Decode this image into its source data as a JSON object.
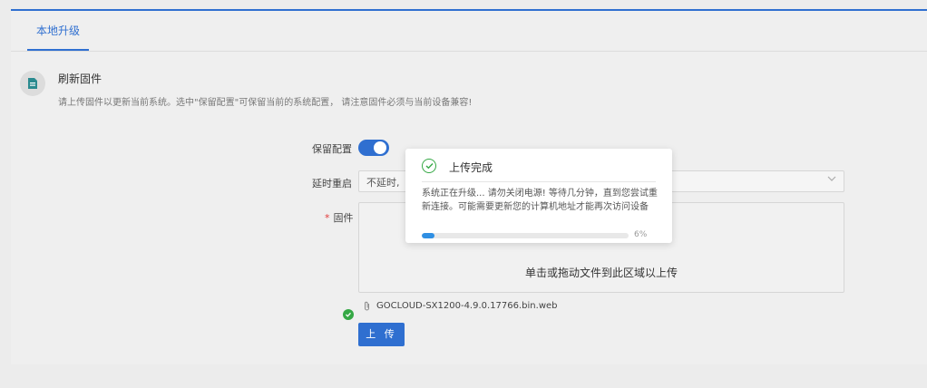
{
  "tabs": [
    {
      "label": "本地升级"
    }
  ],
  "section": {
    "title": "刷新固件",
    "description": "请上传固件以更新当前系统。选中\"保留配置\"可保留当前的系统配置， 请注意固件必须与当前设备兼容!"
  },
  "form": {
    "keep_config_label": "保留配置",
    "keep_config_on": true,
    "delay_restart_label": "延时重启",
    "delay_restart_value": "不延时,",
    "firmware_required_mark": "*",
    "firmware_label": "固件",
    "dropzone_text": "单击或拖动文件到此区域以上传",
    "file_name": "GOCLOUD-SX1200-4.9.0.17766.bin.web",
    "upload_button": "上 传"
  },
  "modal": {
    "title": "上传完成",
    "message": "系统正在升级... 请勿关闭电源! 等待几分钟，直到您尝试重新连接。可能需要更新您的计算机地址才能再次访问设备",
    "progress": 6,
    "progress_text": "6%"
  },
  "colors": {
    "accent": "#2f6fd0",
    "success": "#35a845",
    "progress": "#2f8fe3"
  },
  "icons": {
    "section": "firmware-file-icon",
    "select_arrow": "chevron-down-icon",
    "file_status": "check-circle-icon",
    "file_attach": "paperclip-icon",
    "modal_status": "check-circle-icon"
  }
}
